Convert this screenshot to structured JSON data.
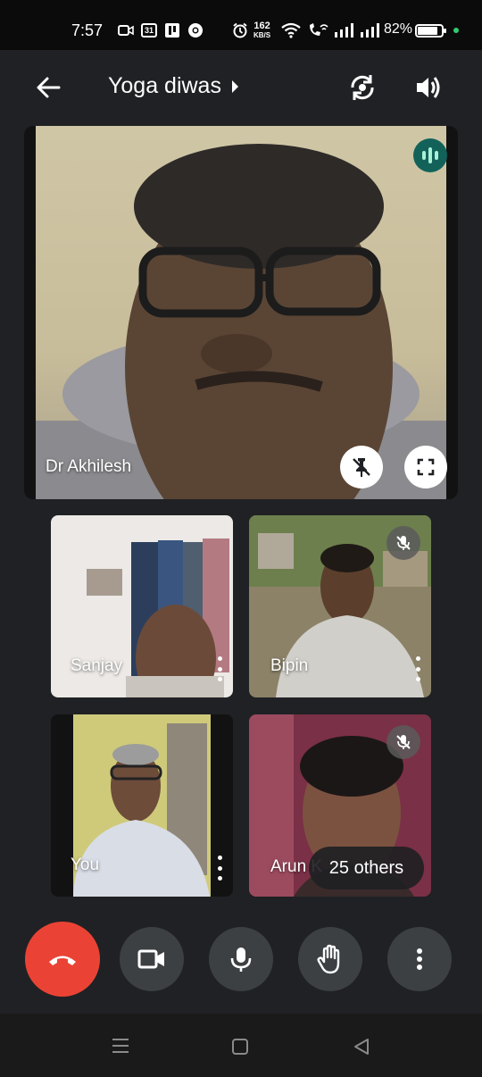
{
  "status_bar": {
    "time": "7:57",
    "calendar_day": "31",
    "speed_value": "162",
    "speed_unit": "KB/S",
    "battery": "82%"
  },
  "header": {
    "title": "Yoga diwas"
  },
  "main_tile": {
    "name": "Dr Akhilesh"
  },
  "tiles": [
    {
      "name": "Sanjay",
      "muted": false
    },
    {
      "name": "Bipin",
      "muted": true
    },
    {
      "name": "You",
      "muted": false
    },
    {
      "name": "Arun K",
      "muted": true
    }
  ],
  "others_label": "25 others",
  "colors": {
    "background": "#202124",
    "end_call": "#ea4335",
    "control": "#3c4043",
    "speaking_badge": "#12625a"
  }
}
